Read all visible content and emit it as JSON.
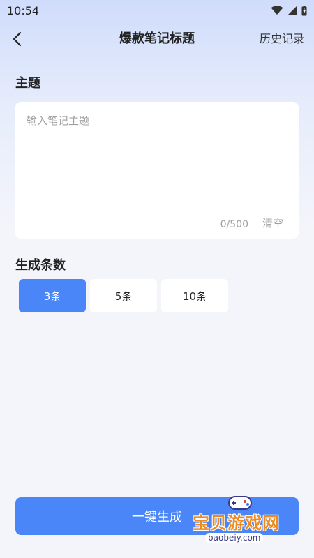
{
  "status_bar": {
    "time": "10:54"
  },
  "header": {
    "title": "爆款笔记标题",
    "history_label": "历史记录"
  },
  "topic": {
    "label": "主题",
    "placeholder": "输入笔记主题",
    "value": "",
    "counter": "0/500",
    "clear_label": "清空"
  },
  "count": {
    "label": "生成条数",
    "options": [
      {
        "label": "3条",
        "selected": true
      },
      {
        "label": "5条",
        "selected": false
      },
      {
        "label": "10条",
        "selected": false
      }
    ]
  },
  "generate_label": "一键生成",
  "watermark": {
    "title": "宝贝游戏网",
    "url": "baobeiy.com"
  },
  "colors": {
    "accent": "#4a86f7",
    "card": "#ffffff",
    "text": "#222222",
    "muted": "#a0a0a0"
  }
}
